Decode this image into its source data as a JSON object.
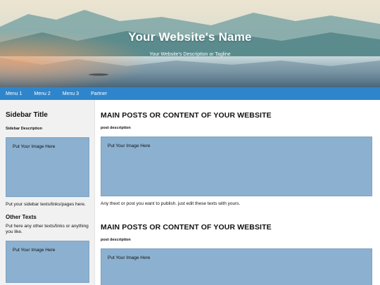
{
  "header": {
    "site_title": "Your Website's Name",
    "tagline": "Your Website's Description or Tagline"
  },
  "nav": {
    "items": [
      "Menu 1",
      "Menu 2",
      "Menu 3",
      "Partner"
    ]
  },
  "sidebar": {
    "title": "Sidebar Title",
    "description": "Sidebar Description",
    "image_placeholder": "Put Your Image Here",
    "text": "Put your sidebar texts/links/pages here.",
    "other_title": "Other Texts",
    "other_text": "Put here any other texts/links or anything you like.",
    "image_placeholder_2": "Put Your Image Here"
  },
  "main": {
    "posts": [
      {
        "title": "MAIN POSTS OR CONTENT OF YOUR WEBSITE",
        "description": "post description",
        "image_placeholder": "Put Your Image Here",
        "text": "Any thext or post you want to publish. just edit these texts with yours."
      },
      {
        "title": "MAIN POSTS OR CONTENT OF YOUR WEBSITE",
        "description": "post description",
        "image_placeholder": "Put Your Image Here"
      }
    ]
  },
  "colors": {
    "nav_bg": "#2f85cb",
    "sidebar_bg": "#f1f1f1",
    "image_placeholder_bg": "#8cb0cf"
  }
}
